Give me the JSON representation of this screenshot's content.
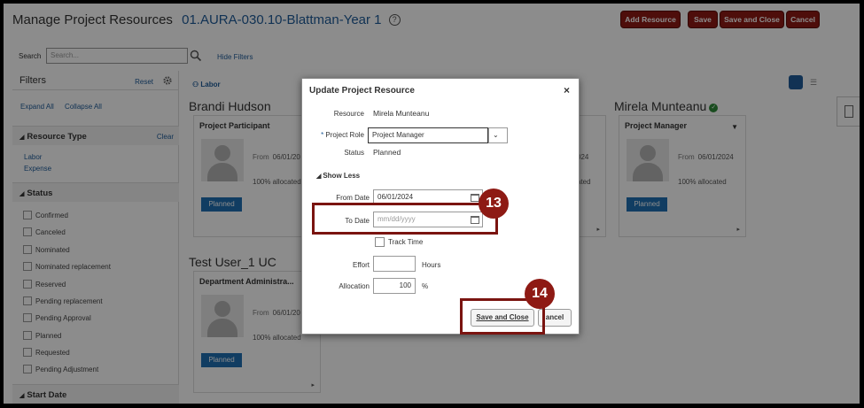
{
  "header": {
    "title": "Manage Project Resources",
    "project": "01.AURA-030.10-Blattman-Year 1",
    "help_icon": "?",
    "buttons": {
      "add_resource": "Add Resource",
      "save": "Save",
      "save_and_close": "Save and Close",
      "cancel": "Cancel"
    },
    "accent_color": "#8e1a14"
  },
  "search": {
    "label": "Search",
    "placeholder": "Search...",
    "hide_filters": "Hide Filters"
  },
  "filters": {
    "title": "Filters",
    "reset": "Reset",
    "expand_all": "Expand All",
    "collapse_all": "Collapse All",
    "resource_type": {
      "title": "Resource Type",
      "clear": "Clear",
      "items": [
        "Labor",
        "Expense"
      ]
    },
    "status": {
      "title": "Status",
      "items": [
        "Confirmed",
        "Canceled",
        "Nominated",
        "Nominated replacement",
        "Reserved",
        "Pending replacement",
        "Pending Approval",
        "Planned",
        "Requested",
        "Pending Adjustment"
      ]
    },
    "start_date": {
      "title": "Start Date"
    }
  },
  "main": {
    "labor_tag": "Labor",
    "cards": [
      {
        "name": "Brandi Hudson",
        "role": "Project Participant",
        "from_label": "From",
        "from": "06/01/20",
        "allocation": "100% allocated",
        "status": "Planned"
      },
      {
        "name": "Mirela Munteanu",
        "role": "Project Manager",
        "from_label": "From",
        "from": "06/01/2024",
        "allocation": "100% allocated",
        "status": "Planned"
      },
      {
        "name": "Test User_1 UC",
        "role": "Department Administra...",
        "from_label": "From",
        "from": "06/01/20",
        "allocation": "100% allocated",
        "status": "Planned"
      }
    ],
    "partial_card": {
      "from": "024",
      "allocation": "ated"
    }
  },
  "dialog": {
    "title": "Update Project Resource",
    "close": "×",
    "resource_label": "Resource",
    "resource_value": "Mirela Munteanu",
    "role_label": "Project Role",
    "required_mark": "*",
    "role_value": "Project Manager",
    "status_label": "Status",
    "status_value": "Planned",
    "show_less": "Show Less",
    "from_date_label": "From Date",
    "from_date_value": "06/01/2024",
    "to_date_label": "To Date",
    "to_date_placeholder": "mm/dd/yyyy",
    "track_time_label": "Track Time",
    "effort_label": "Effort",
    "effort_unit": "Hours",
    "allocation_label": "Allocation",
    "allocation_value": "100",
    "allocation_unit": "%",
    "save_and_close": "Save and Close",
    "cancel": "ancel"
  },
  "callouts": {
    "step_13": "13",
    "step_14": "14",
    "color": "#7a1410"
  }
}
